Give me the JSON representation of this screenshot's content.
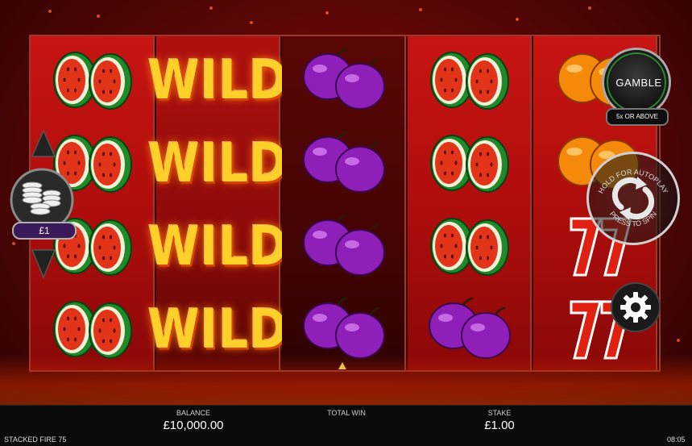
{
  "game": {
    "title": "STACKED FIRE 75",
    "clock": "08:05"
  },
  "reels": [
    {
      "style": "red",
      "symbols": [
        "watermelon",
        "watermelon",
        "watermelon",
        "watermelon"
      ]
    },
    {
      "style": "wild-bg",
      "symbols": [
        "wild",
        "wild",
        "wild",
        "wild"
      ]
    },
    {
      "style": "dark",
      "symbols": [
        "plum",
        "plum",
        "plum",
        "plum"
      ]
    },
    {
      "style": "red",
      "symbols": [
        "watermelon",
        "watermelon",
        "watermelon",
        "plum"
      ]
    },
    {
      "style": "red",
      "symbols": [
        "orange",
        "orange",
        "seven",
        "seven"
      ]
    }
  ],
  "symbol_labels": {
    "wild": "WILD"
  },
  "stake_widget": {
    "value": "£1",
    "icon": "coin-stack-icon"
  },
  "gamble": {
    "label": "GAMBLE",
    "sublabel": "5x OR ABOVE"
  },
  "spin": {
    "top_text": "HOLD FOR AUTOPLAY",
    "bottom_text": "PRESS TO SPIN",
    "icon": "spin-arrows-icon"
  },
  "settings": {
    "icon": "gear-icon"
  },
  "bottom_bar": {
    "balance_label": "BALANCE",
    "balance_value": "£10,000.00",
    "total_win_label": "TOTAL WIN",
    "total_win_value": "",
    "stake_label": "STAKE",
    "stake_value": "£1.00"
  },
  "colors": {
    "reel_red": "#c81414",
    "wild_yellow": "#ffcf2a",
    "plum": "#8e1fb8",
    "melon_green": "#1f8a2a",
    "gamble_ring": "#2e8a2e"
  }
}
